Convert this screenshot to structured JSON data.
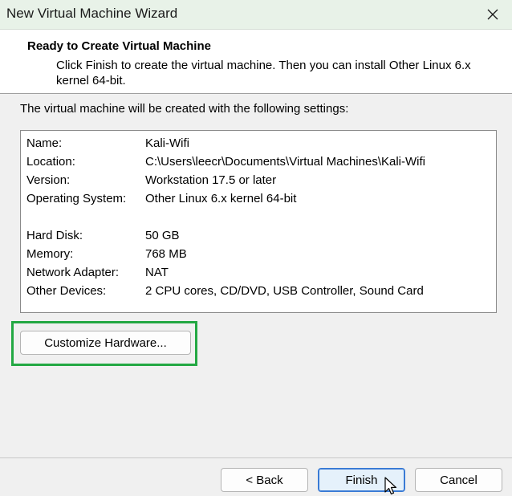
{
  "window": {
    "title": "New Virtual Machine Wizard",
    "close_icon": "close-icon"
  },
  "header": {
    "title": "Ready to Create Virtual Machine",
    "description": "Click Finish to create the virtual machine. Then you can install Other Linux 6.x kernel 64-bit."
  },
  "intro": "The virtual machine will be created with the following settings:",
  "settings": {
    "name": {
      "label": "Name:",
      "value": "Kali-Wifi"
    },
    "location": {
      "label": "Location:",
      "value": "C:\\Users\\leecr\\Documents\\Virtual Machines\\Kali-Wifi"
    },
    "version": {
      "label": "Version:",
      "value": "Workstation 17.5 or later"
    },
    "os": {
      "label": "Operating System:",
      "value": "Other Linux 6.x kernel 64-bit"
    },
    "hard_disk": {
      "label": "Hard Disk:",
      "value": "50 GB"
    },
    "memory": {
      "label": "Memory:",
      "value": "768 MB"
    },
    "network": {
      "label": "Network Adapter:",
      "value": "NAT"
    },
    "other_devices": {
      "label": "Other Devices:",
      "value": "2 CPU cores, CD/DVD, USB Controller, Sound Card"
    }
  },
  "buttons": {
    "customize": "Customize Hardware...",
    "back": "< Back",
    "finish": "Finish",
    "cancel": "Cancel"
  },
  "colors": {
    "highlight": "#23a843",
    "titlebar": "#e8f2e8",
    "default_button_border": "#3a7bd5"
  }
}
